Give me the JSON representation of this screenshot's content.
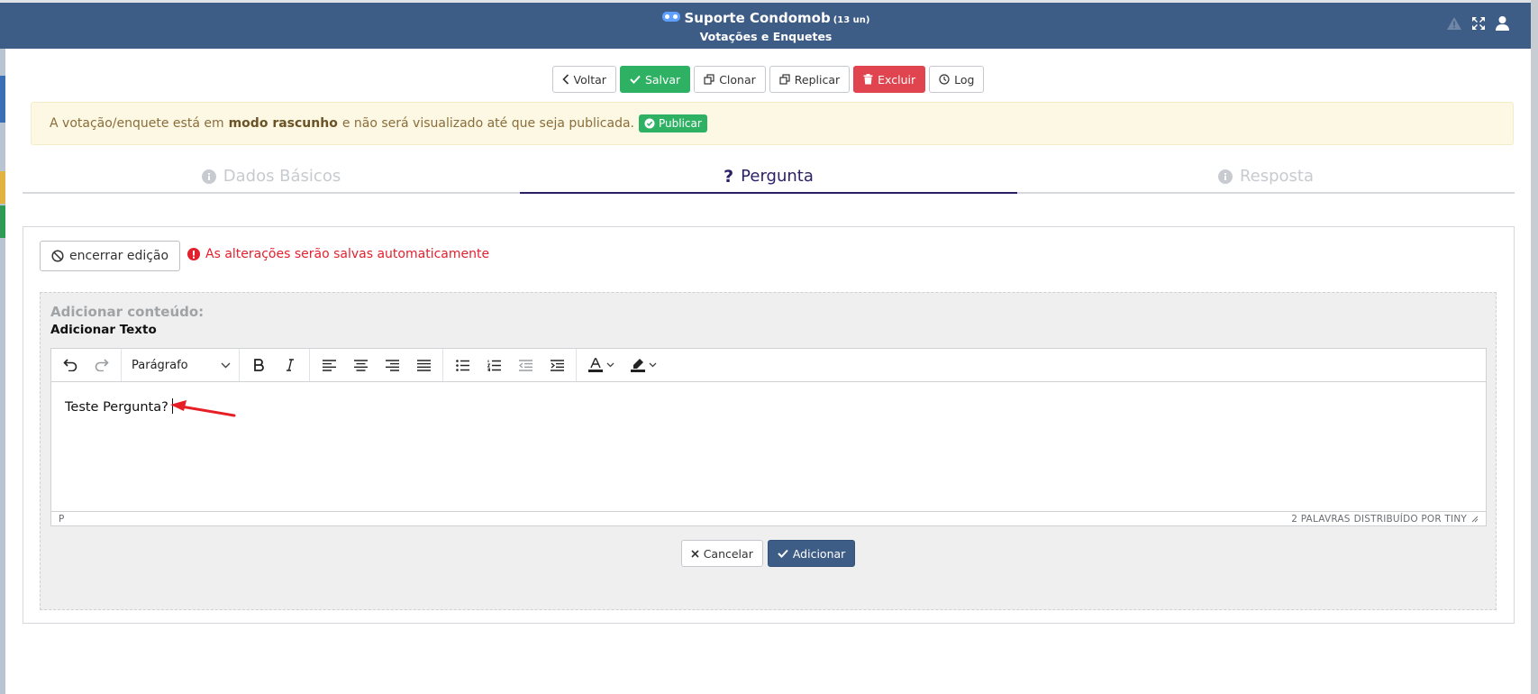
{
  "header": {
    "title": "Suporte Condomob",
    "unit_count": "(13 un)",
    "subtitle": "Votações e Enquetes",
    "icons": [
      "warning-icon",
      "expand-icon",
      "user-icon"
    ]
  },
  "toolbar": {
    "back": "Voltar",
    "save": "Salvar",
    "clone": "Clonar",
    "replicate": "Replicar",
    "delete": "Excluir",
    "log": "Log"
  },
  "draft_alert": {
    "prefix": "A votação/enquete está em",
    "bold": "modo rascunho",
    "suffix": "e não será visualizado até que seja publicada.",
    "publish": "Publicar"
  },
  "tabs": [
    {
      "label": "Dados Básicos",
      "active": false
    },
    {
      "label": "Pergunta",
      "active": true
    },
    {
      "label": "Resposta",
      "active": false
    }
  ],
  "editing": {
    "end_edit": "encerrar edição",
    "autosave_note": "As alterações serão salvas automaticamente"
  },
  "add_content": {
    "heading": "Adicionar conteúdo:",
    "subheading": "Adicionar Texto"
  },
  "editor": {
    "block_format": "Parágrafo",
    "content": "Teste Pergunta?",
    "status_path": "P",
    "word_count": "2 PALAVRAS",
    "powered_by": "DISTRIBUÍDO POR TINY"
  },
  "actions": {
    "cancel": "Cancelar",
    "add": "Adicionar"
  },
  "colors": {
    "header_bg": "#3e5d86",
    "save_green": "#2fb163",
    "delete_red": "#e0454f",
    "active_tab": "#2b1f66",
    "alert_text": "#e3202e"
  }
}
